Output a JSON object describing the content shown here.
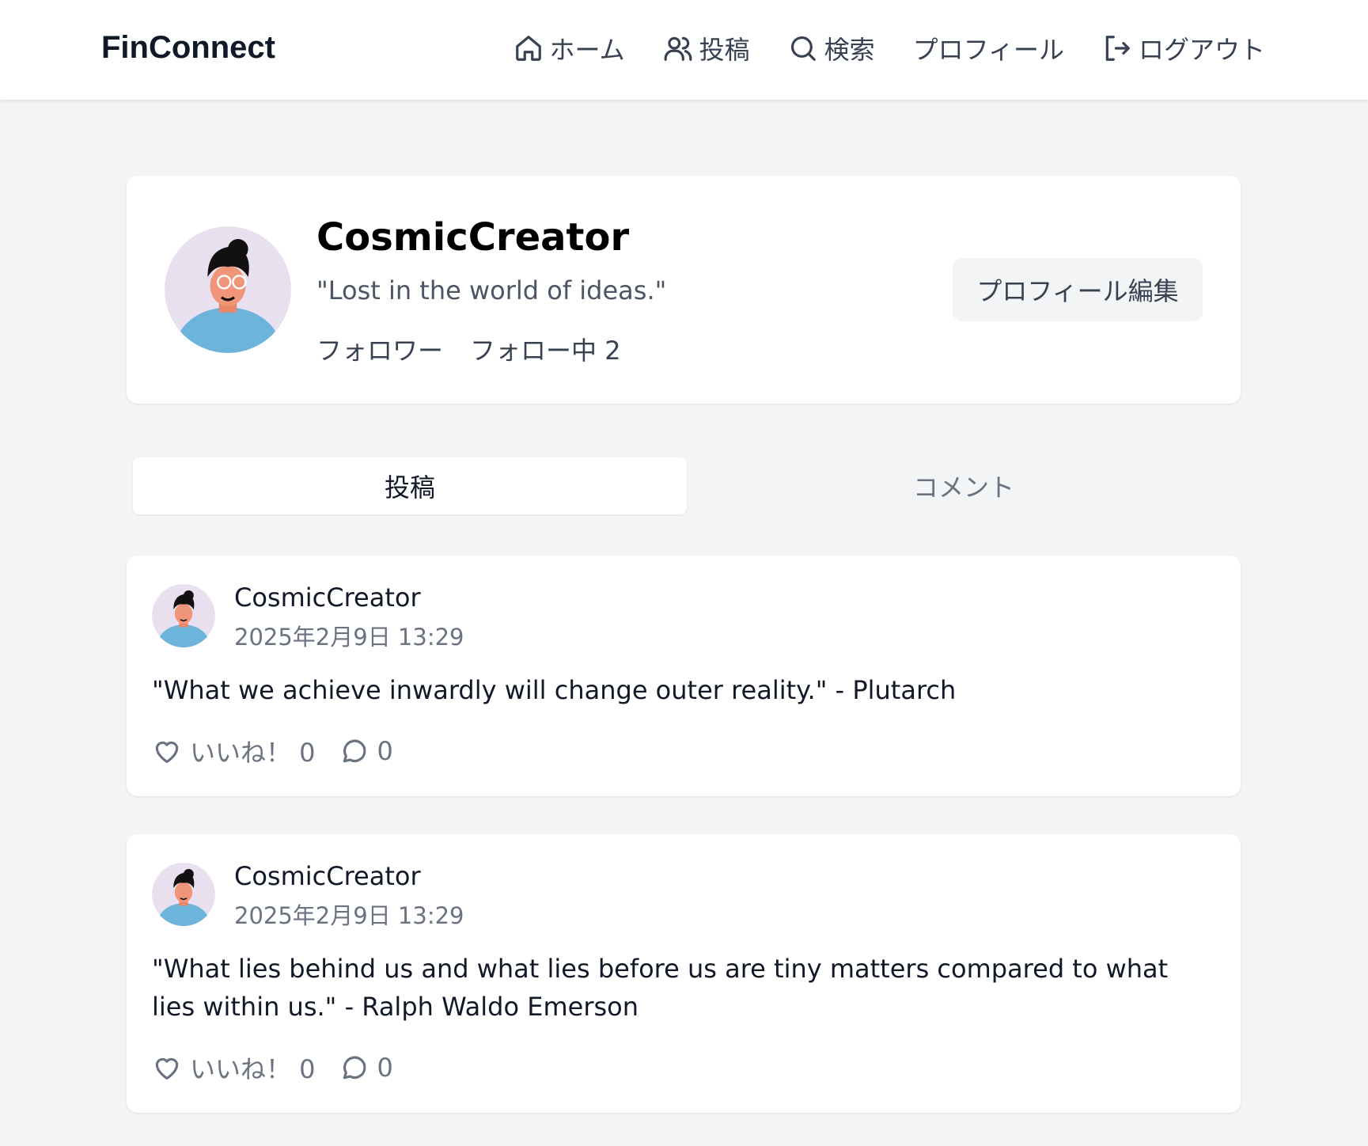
{
  "brand": "FinConnect",
  "nav": {
    "home": "ホーム",
    "posts": "投稿",
    "search": "検索",
    "profile": "プロフィール",
    "logout": "ログアウト"
  },
  "profile": {
    "name": "CosmicCreator",
    "bio": "\"Lost in the world of ideas.\"",
    "followers_label": "フォロワー",
    "following_label": "フォロー中 2",
    "edit_button": "プロフィール編集"
  },
  "tabs": {
    "posts": "投稿",
    "comments": "コメント"
  },
  "posts": [
    {
      "author": "CosmicCreator",
      "date": "2025年2月9日 13:29",
      "body": "\"What we achieve inwardly will change outer reality.\" - Plutarch",
      "likes": "いいね！ 0",
      "comments": "0"
    },
    {
      "author": "CosmicCreator",
      "date": "2025年2月9日 13:29",
      "body": "\"What lies behind us and what lies before us are tiny matters compared to what lies within us.\" - Ralph Waldo Emerson",
      "likes": "いいね！ 0",
      "comments": "0"
    }
  ],
  "icons": {
    "home": "home-icon",
    "posts": "users-icon",
    "search": "search-icon",
    "logout": "logout-icon",
    "like": "heart-icon",
    "comment": "comment-icon"
  },
  "colors": {
    "background": "#f3f4f6",
    "card": "#ffffff",
    "avatar_bg": "#e9e0ef",
    "avatar_shirt": "#6cb4d9",
    "muted_text": "#6b7280"
  }
}
